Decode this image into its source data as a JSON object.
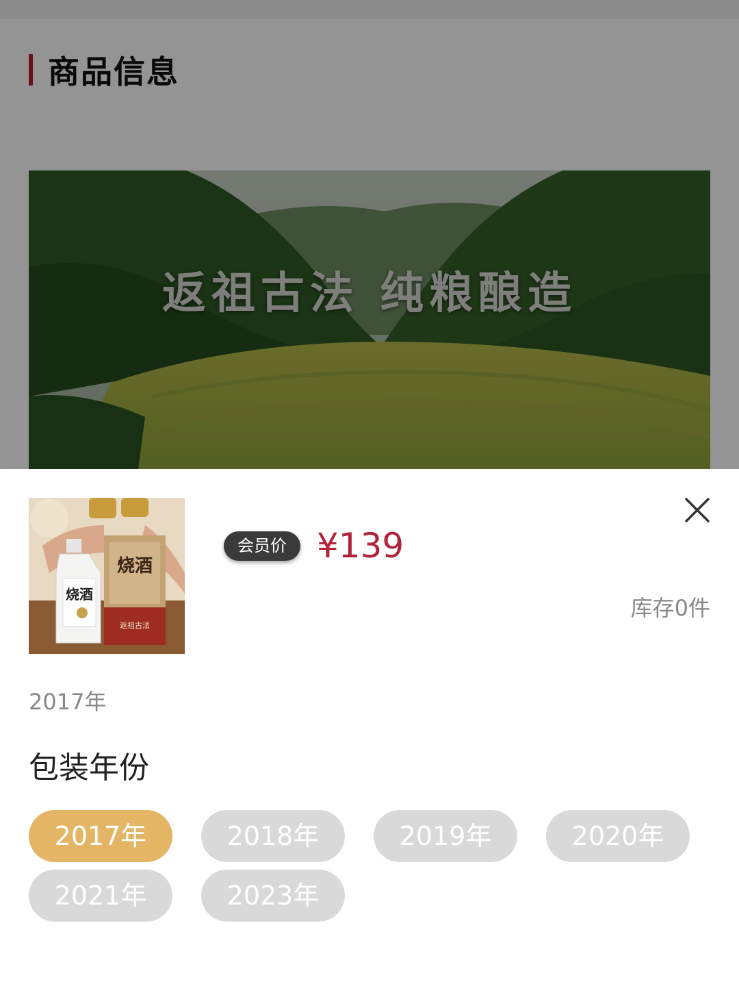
{
  "section": {
    "title": "商品信息"
  },
  "banner": {
    "caption": "返祖古法  纯粮酿造"
  },
  "sheet": {
    "member_badge": "会员价",
    "price": "¥139",
    "stock": "库存0件",
    "selected_spec": "2017年",
    "spec_label": "包装年份",
    "options": [
      {
        "label": "2017年",
        "selected": true
      },
      {
        "label": "2018年",
        "selected": false
      },
      {
        "label": "2019年",
        "selected": false
      },
      {
        "label": "2020年",
        "selected": false
      },
      {
        "label": "2021年",
        "selected": false
      },
      {
        "label": "2023年",
        "selected": false
      }
    ],
    "product_image": {
      "bottle_label": "烧酒",
      "box_label": "烧酒",
      "box_sub_label": "返祖古法"
    }
  },
  "colors": {
    "accent_red": "#b11f2c",
    "price_red": "#b1233a",
    "selected_option": "#e3b565",
    "unselected_option": "#d9d9d9"
  },
  "icons": {
    "close": "close-icon"
  }
}
